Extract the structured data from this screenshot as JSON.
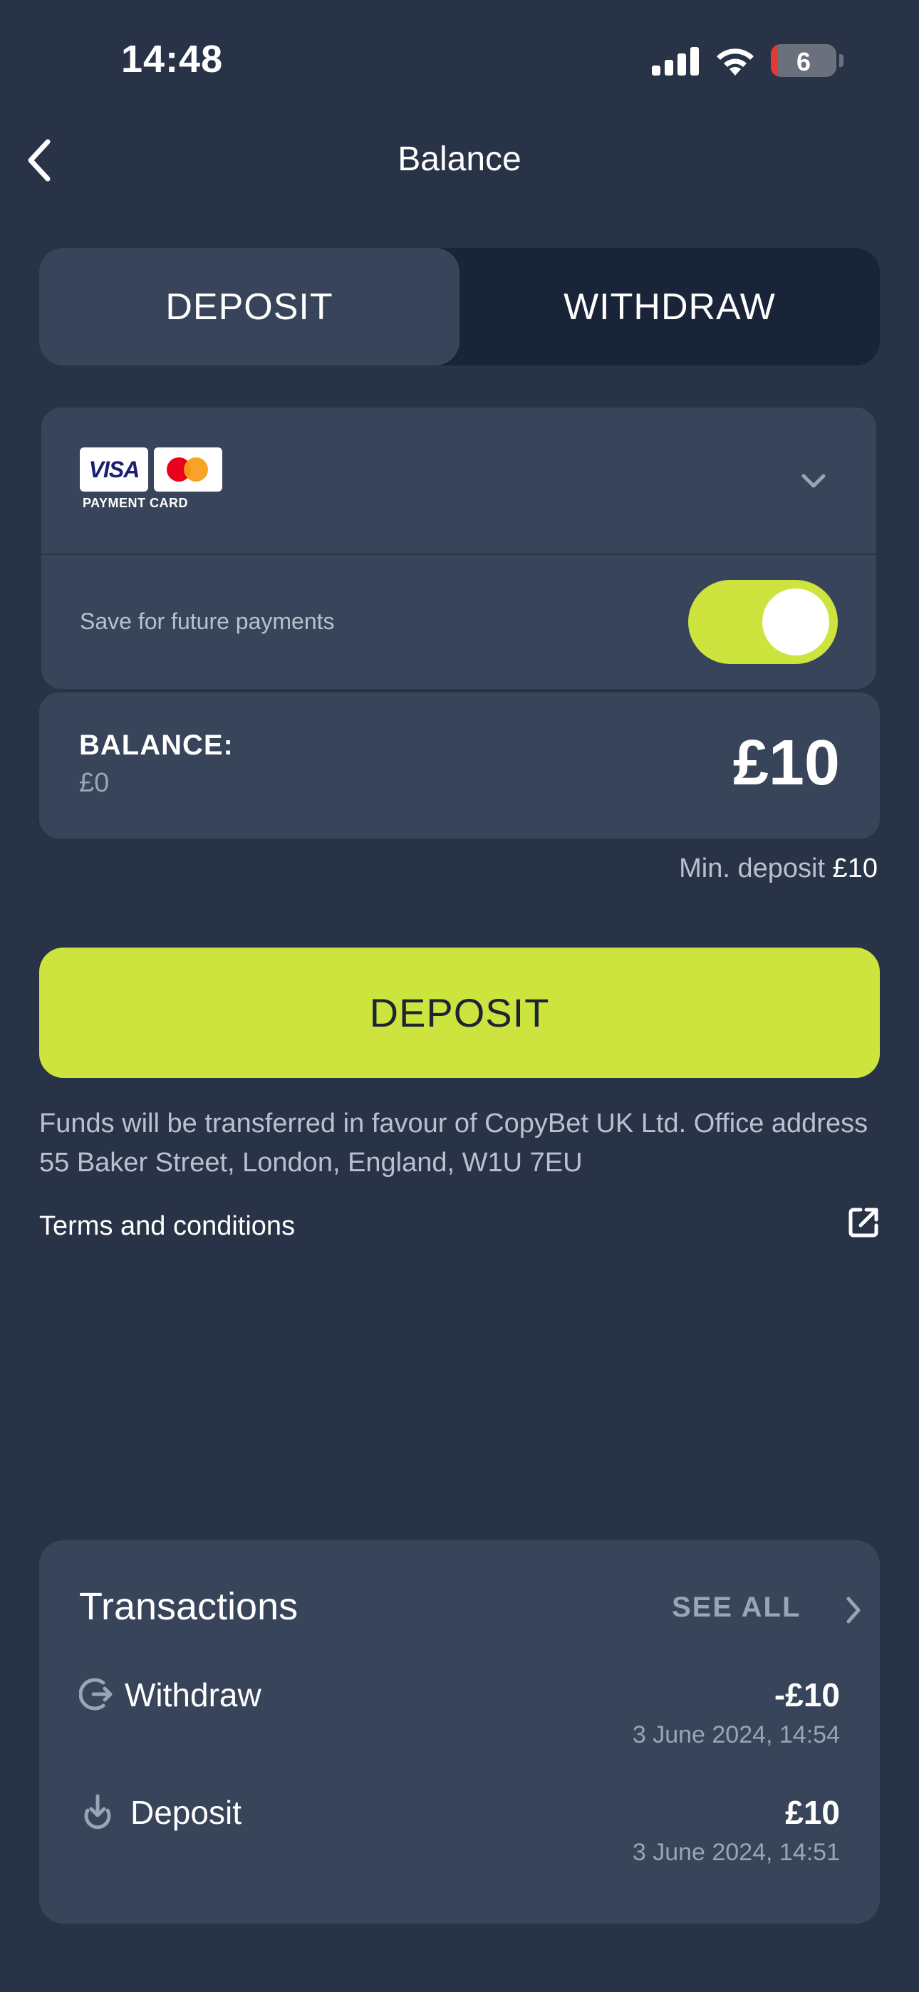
{
  "status_bar": {
    "time": "14:48",
    "battery_level": "6"
  },
  "header": {
    "title": "Balance",
    "back_icon": "chevron-left-icon"
  },
  "tabs": [
    {
      "label": "DEPOSIT",
      "active": true
    },
    {
      "label": "WITHDRAW",
      "active": false
    }
  ],
  "payment_method": {
    "visa_label": "VISA",
    "card_label": "PAYMENT CARD",
    "dropdown_icon": "chevron-down-icon",
    "save_label": "Save for future payments",
    "save_enabled": true
  },
  "balance": {
    "label": "BALANCE:",
    "value": "£0",
    "amount": "£10"
  },
  "min_deposit": {
    "label": "Min. deposit",
    "value": "£10"
  },
  "deposit_button": {
    "label": "DEPOSIT"
  },
  "funds_text": "Funds will be transferred in favour of CopyBet UK Ltd. Office address 55 Baker Street, London, England, W1U 7EU",
  "terms": {
    "label": "Terms and conditions",
    "icon": "external-link-icon"
  },
  "transactions": {
    "title": "Transactions",
    "see_all": "SEE ALL",
    "items": [
      {
        "type": "Withdraw",
        "amount": "-£10",
        "date": "3 June 2024, 14:54",
        "icon": "withdraw-icon"
      },
      {
        "type": "Deposit",
        "amount": "£10",
        "date": "3 June 2024, 14:51",
        "icon": "deposit-icon"
      }
    ]
  },
  "colors": {
    "background": "#283347",
    "card": "#374459",
    "accent": "#cde43e",
    "muted_text": "#9aa4b5"
  }
}
